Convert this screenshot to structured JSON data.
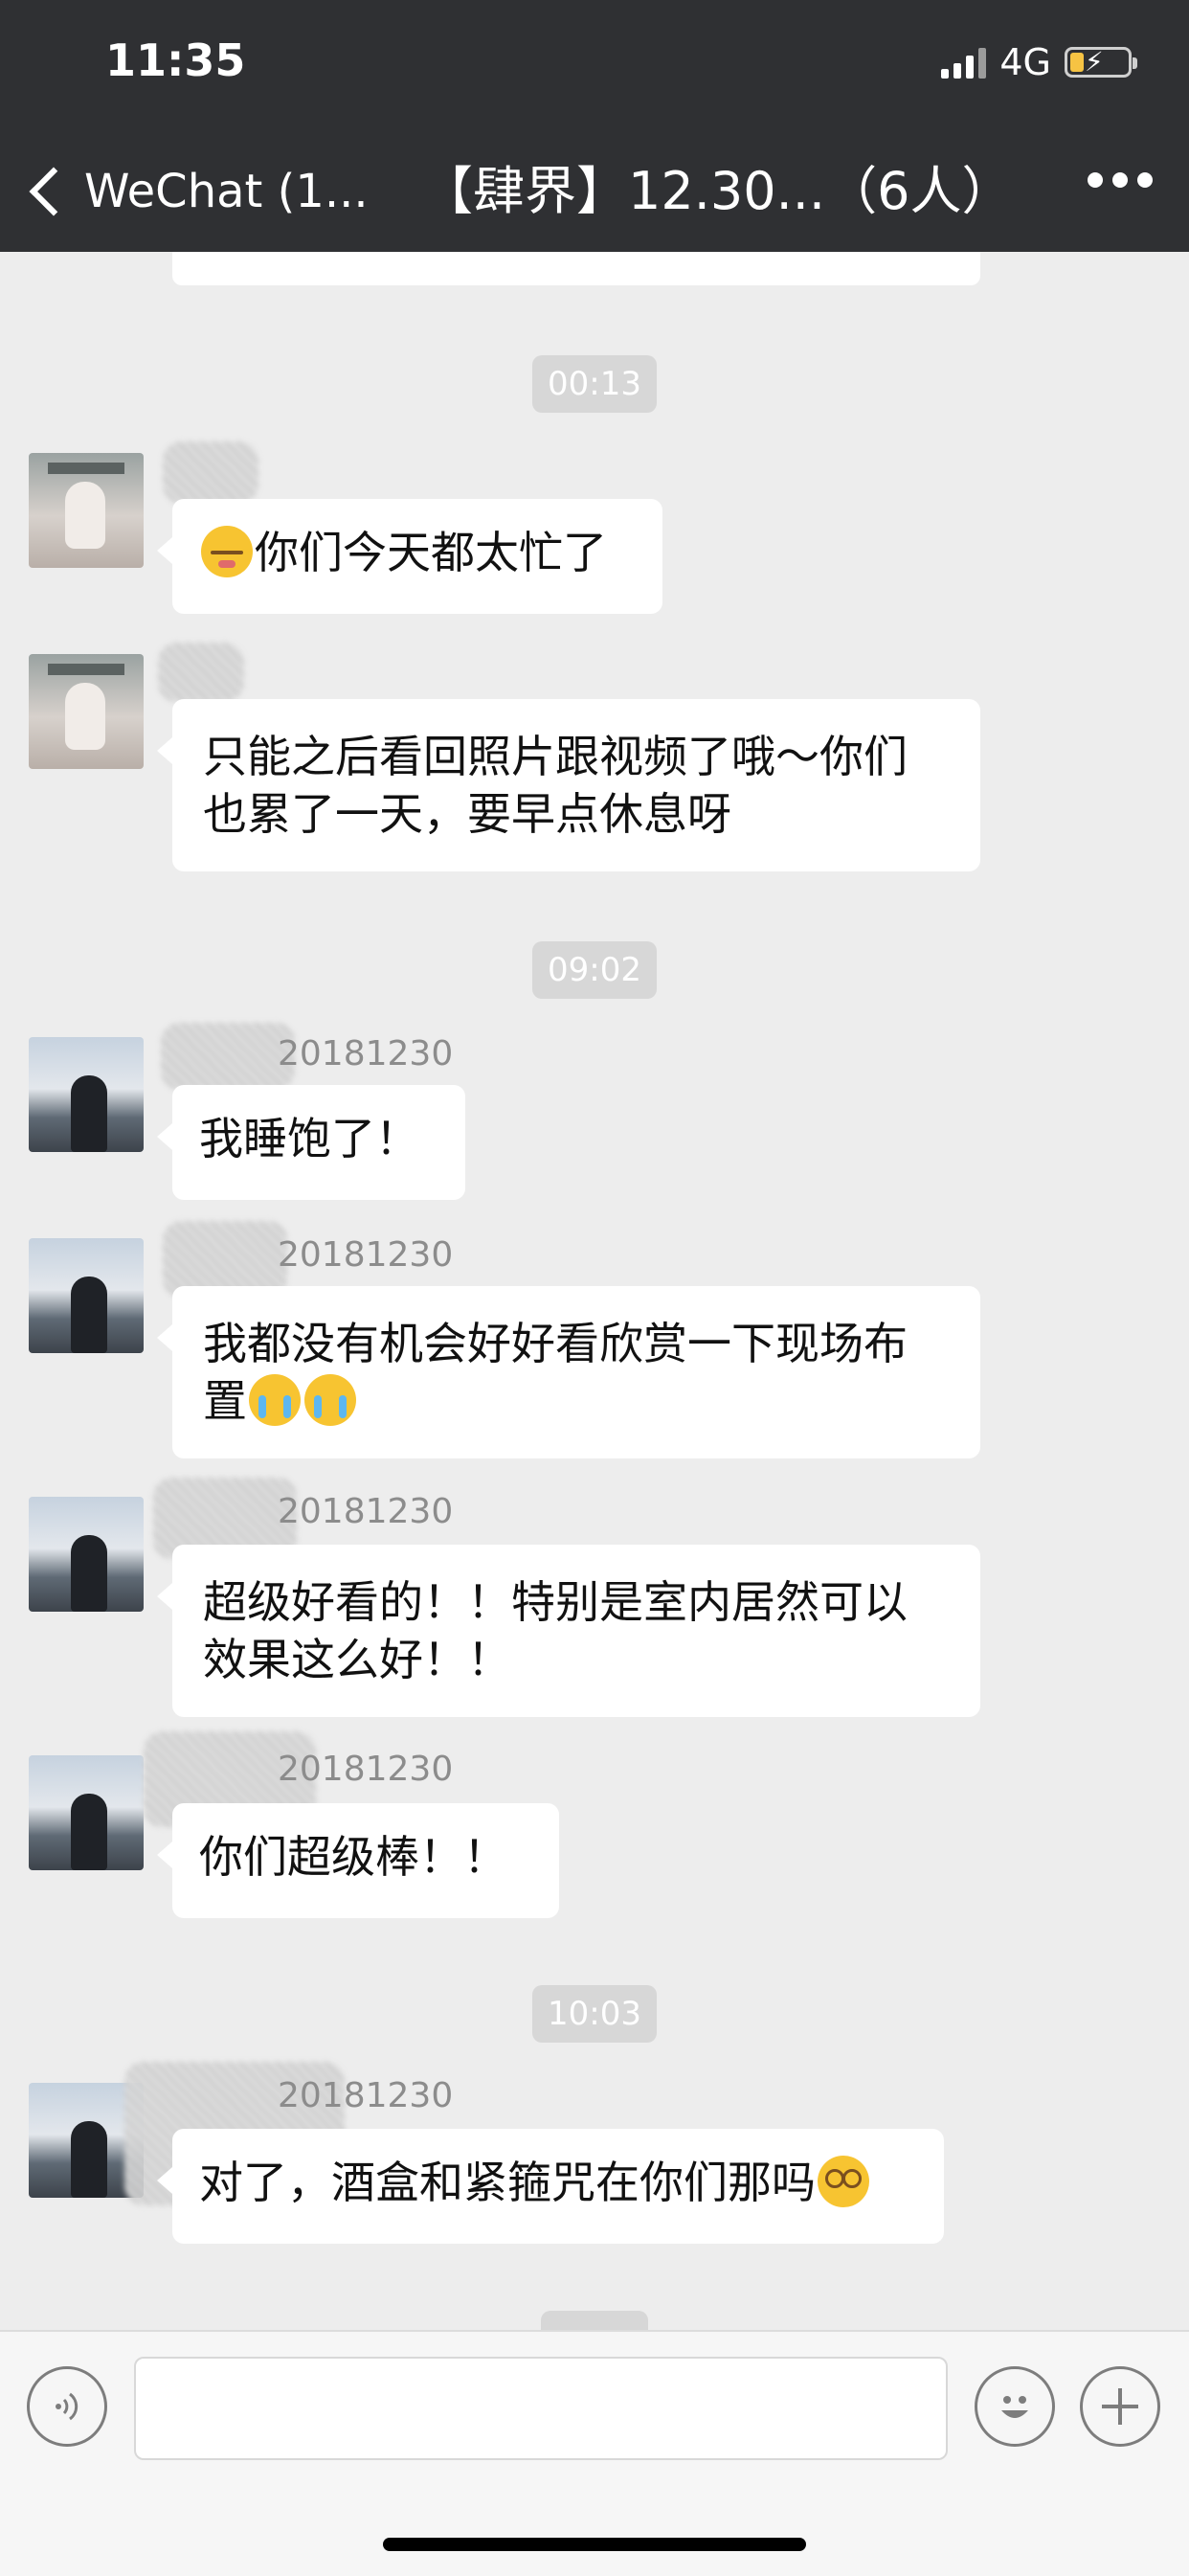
{
  "status": {
    "time": "11:35",
    "network": "4G"
  },
  "nav": {
    "back_label": "WeChat (1...",
    "title": "【肆界】12.30...（6人）"
  },
  "messages": {
    "ts1": "00:13",
    "ts2": "09:02",
    "ts3": "10:03",
    "m1": "你们今天都太忙了",
    "m2": "只能之后看回照片跟视频了哦～你们也累了一天，要早点休息呀",
    "s3": "20181230",
    "m3": "我睡饱了！",
    "s4": "20181230",
    "m4": "我都没有机会好好看欣赏一下现场布置",
    "s5": "20181230",
    "m5": "超级好看的！！特别是室内居然可以效果这么好！！",
    "s6": "20181230",
    "m6": "你们超级棒！！",
    "s7": "20181230",
    "m7": "对了，酒盒和紧箍咒在你们那吗"
  },
  "icons": {
    "voice": "voice-icon",
    "emoji": "emoji-icon",
    "plus": "plus-icon",
    "more": "more-icon"
  }
}
